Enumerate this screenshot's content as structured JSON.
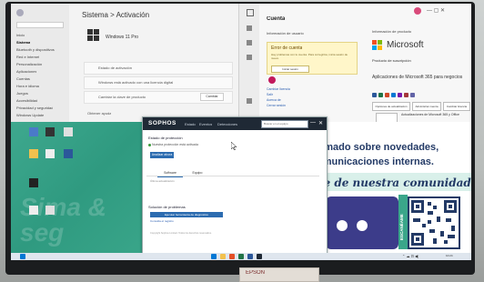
{
  "settings": {
    "breadcrumb": "Sistema  >  Activación",
    "edition": "Windows 11 Pro",
    "sidebar": [
      "Inicio",
      "Sistema",
      "Bluetooth y dispositivos",
      "Red e Internet",
      "Personalización",
      "Aplicaciones",
      "Cuentas",
      "Hora e idioma",
      "Juegos",
      "Accesibilidad",
      "Privacidad y seguridad",
      "Windows Update"
    ],
    "rows": [
      {
        "label": "Estado de activación",
        "action": ""
      },
      {
        "label": "Windows está activado con una licencia digital",
        "action": ""
      },
      {
        "label": "Cambiar la clave de producto",
        "action": "Cambiar"
      }
    ],
    "help_label": "Obtener ayuda"
  },
  "account": {
    "title": "Cuenta",
    "info_header": "Información de usuario",
    "error_title": "Error de cuenta",
    "error_text": "Hay problemas con tu cuenta. Para corregirlos, inicia sesión de nuevo.",
    "error_button": "Iniciar sesión",
    "links": [
      "Cambiar licencia",
      "Salir",
      "Acerca de",
      "Cerrar sesión"
    ],
    "product_header": "Información de producto",
    "brand": "Microsoft",
    "product_sub": "Producto de suscripción",
    "apps_title": "Aplicaciones de Microsoft 365 para negocios",
    "buttons": [
      "Opciones de actualización",
      "Administrar cuenta",
      "Cambiar licencia"
    ],
    "updates_text": "Actualizaciones de Microsoft 365 y Office"
  },
  "sophos": {
    "brand": "SOPHOS",
    "nav": [
      "Estado",
      "Eventos",
      "Detecciones"
    ],
    "search_placeholder": "Buscar en el equipo",
    "section_status": "Estado de protección",
    "status_text": "Nuestra protección está activada",
    "scan_button": "Analizar ahora",
    "tabs": [
      "Software",
      "Equipo"
    ],
    "meta": "Última actualización",
    "section_troubleshoot": "Solución de problemas",
    "troubleshoot_button": "Ejecutar herramienta de diagnóstico",
    "troubleshoot_link": "Consulta el registro",
    "copyright": "Copyright Sophos Limited. Todos los derechos reservados."
  },
  "desktop": {
    "watermark": "Sima & seg"
  },
  "banner": {
    "line1": "rmado sobre novedades,",
    "line2": "omunicaciones internas.",
    "line3": "te de nuestra comunidad.",
    "scan": "ESCANÉAME"
  },
  "taskbar": {
    "clock": "10:24"
  },
  "monitor": {
    "label": "EPSON"
  },
  "colors": {
    "desktop_green": "#3ea88e",
    "banner_navy": "#233a66",
    "sophos_bar": "#1f2935",
    "accent_blue": "#2c6cb0",
    "error_yellow": "#fff6c9"
  }
}
